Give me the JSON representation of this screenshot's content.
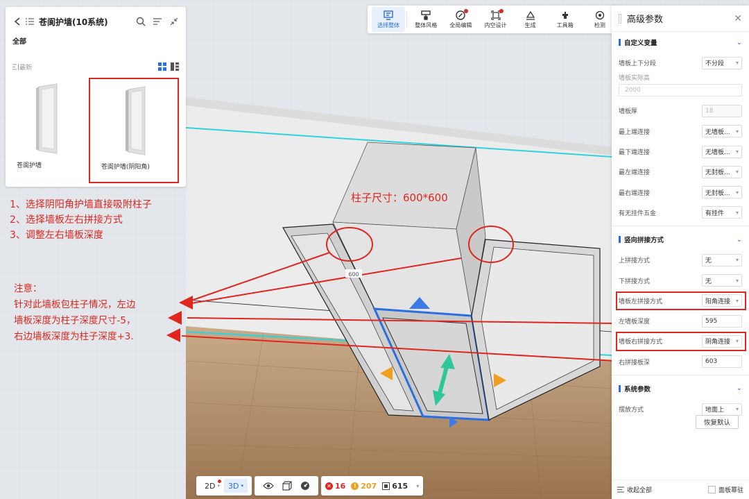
{
  "left_panel": {
    "title": "苍阆护墙(10系统)",
    "category": "全部",
    "sort_label": "最新",
    "cards": [
      {
        "label": "苍阆护墙"
      },
      {
        "label": "苍阆护墙(阴阳角)"
      }
    ]
  },
  "annotations": {
    "instructions": [
      "1、选择阴阳角护墙直接吸附柱子",
      "2、选择墙板左右拼接方式",
      "3、调整左右墙板深度"
    ],
    "note_title": "注意：",
    "note_lines": [
      "针对此墙板包柱子情况，左边",
      "墙板深度为柱子深度尺寸-5，",
      "右边墙板深度为柱子深度+3."
    ],
    "column_size": "柱子尺寸：600*600",
    "dimension_value": "600"
  },
  "top_toolbar": {
    "buttons": [
      {
        "label": "选择整体",
        "icon": "select-all-icon",
        "active": true
      },
      {
        "label": "整体风格",
        "icon": "style-icon"
      },
      {
        "label": "全局编辑",
        "icon": "global-edit-icon"
      },
      {
        "label": "内空设计",
        "icon": "inner-design-icon"
      },
      {
        "label": "生成",
        "icon": "generate-icon"
      },
      {
        "label": "工具箱",
        "icon": "toolbox-icon"
      },
      {
        "label": "检测",
        "icon": "detect-icon"
      }
    ]
  },
  "right_panel": {
    "title": "高级参数",
    "sections": {
      "custom": {
        "title": "自定义变量",
        "rows": [
          {
            "label": "墙板上下分段",
            "value": "不分段"
          },
          {
            "label": "墙板实际高",
            "value": "2000"
          },
          {
            "label": "墙板厚",
            "value": "18"
          },
          {
            "label": "最上端连接",
            "value": "无墙板..."
          },
          {
            "label": "最下端连接",
            "value": "无墙板..."
          },
          {
            "label": "最左端连接",
            "value": "无封板..."
          },
          {
            "label": "最右端连接",
            "value": "无封板..."
          },
          {
            "label": "有无挂件五金",
            "value": "有挂件"
          }
        ]
      },
      "vertical": {
        "title": "竖向拼接方式",
        "rows": [
          {
            "label": "上拼接方式",
            "value": "无"
          },
          {
            "label": "下拼接方式",
            "value": "无"
          },
          {
            "label": "墙板左拼接方式",
            "value": "阳角连接"
          },
          {
            "label": "左墙板深度",
            "value": "595"
          },
          {
            "label": "墙板右拼接方式",
            "value": "阴角连接"
          },
          {
            "label": "右拼接板深",
            "value": "603"
          }
        ]
      },
      "system": {
        "title": "系统参数",
        "rows": [
          {
            "label": "摆放方式",
            "value": "地面上"
          }
        ]
      }
    },
    "restore_label": "恢复默认",
    "collapse_label": "收起全部",
    "checkbox_label": "面板幂驻"
  },
  "bottom_bar": {
    "view_2d": "2D",
    "view_3d": "3D",
    "error_count": "16",
    "warning_count": "207",
    "item_count": "615"
  },
  "colors": {
    "accent": "#2a6ee0",
    "annotation_red": "#e0261e",
    "floor": "#a98563",
    "wall": "#ececec",
    "cyan_line": "#2fd3df"
  }
}
